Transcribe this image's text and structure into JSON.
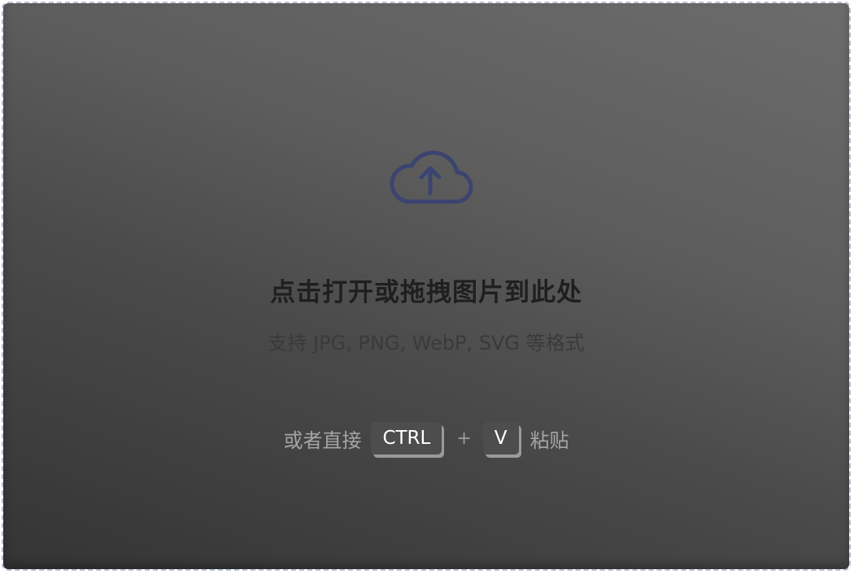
{
  "dropzone": {
    "title": "点击打开或拖拽图片到此处",
    "subtitle": "支持 JPG, PNG, WebP, SVG 等格式",
    "icon": "cloud-upload-icon",
    "icon_color": "#3b4470",
    "paste_hint": {
      "prefix": "或者直接",
      "key1": "CTRL",
      "plus": "+",
      "key2": "V",
      "suffix": "粘贴"
    }
  }
}
